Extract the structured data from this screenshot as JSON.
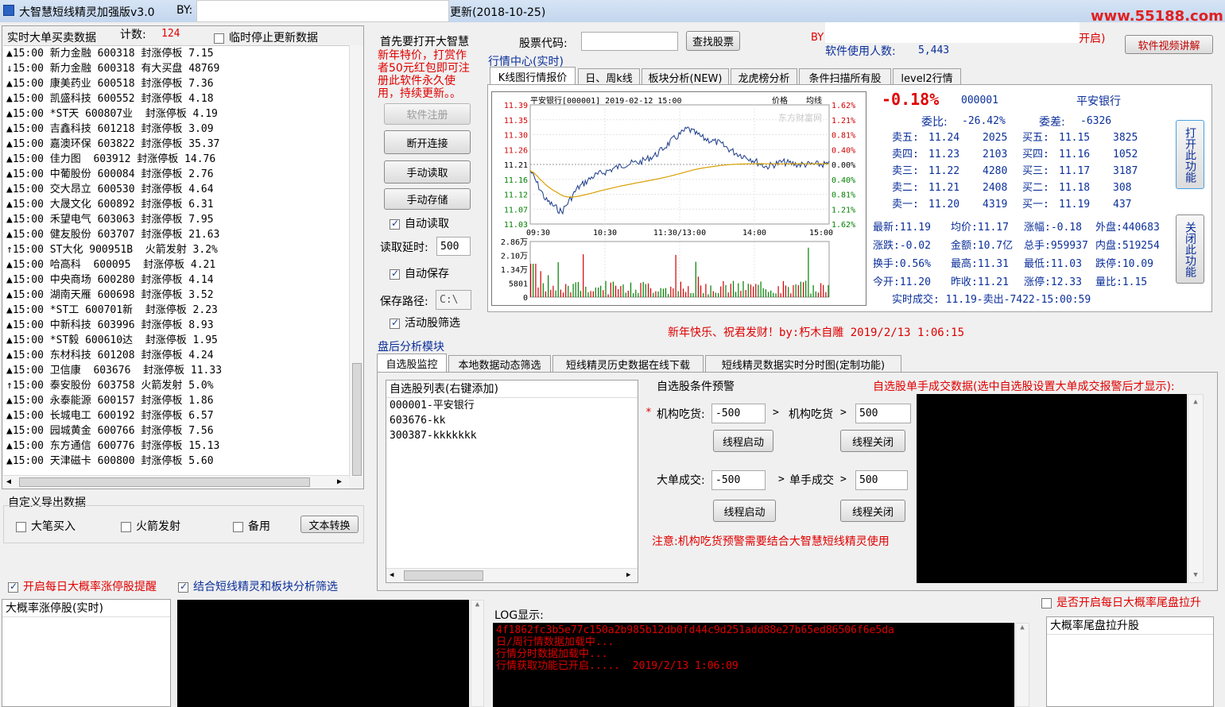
{
  "window": {
    "title": "大智慧短线精灵加强版v3.0",
    "by_label": "BY:",
    "update_suffix": "更新(2018-10-25)",
    "logo_url": "www.55188.com"
  },
  "left": {
    "header_title": "实时大单买卖数据",
    "count_label": "计数:",
    "count_value": "124",
    "pause_label": "临时停止更新数据",
    "rows": [
      {
        "arrow": "▲",
        "text": "15:00 新力金融 600318 封涨停板 7.15"
      },
      {
        "arrow": "↓",
        "text": "15:00 新力金融 600318 有大买盘 48769"
      },
      {
        "arrow": "▲",
        "text": "15:00 康美药业 600518 封涨停板 7.36"
      },
      {
        "arrow": "▲",
        "text": "15:00 凯盛科技 600552 封涨停板 4.18"
      },
      {
        "arrow": "▲",
        "text": "15:00 *ST天 600807业  封涨停板 4.19"
      },
      {
        "arrow": "▲",
        "text": "15:00 吉鑫科技 601218 封涨停板 3.09"
      },
      {
        "arrow": "▲",
        "text": "15:00 嘉澳环保 603822 封涨停板 35.37"
      },
      {
        "arrow": "▲",
        "text": "15:00 佳力图  603912 封涨停板 14.76"
      },
      {
        "arrow": "▲",
        "text": "15:00 中葡股份 600084 封涨停板 2.76"
      },
      {
        "arrow": "▲",
        "text": "15:00 交大昂立 600530 封涨停板 4.64"
      },
      {
        "arrow": "▲",
        "text": "15:00 大晟文化 600892 封涨停板 6.31"
      },
      {
        "arrow": "▲",
        "text": "15:00 禾望电气 603063 封涨停板 7.95"
      },
      {
        "arrow": "▲",
        "text": "15:00 健友股份 603707 封涨停板 21.63"
      },
      {
        "arrow": "↑",
        "text": "15:00 ST大化 900951B  火箭发射 3.2%"
      },
      {
        "arrow": "▲",
        "text": "15:00 哈高科  600095  封涨停板 4.21"
      },
      {
        "arrow": "▲",
        "text": "15:00 中央商场 600280 封涨停板 4.14"
      },
      {
        "arrow": "▲",
        "text": "15:00 湖南天雁 600698 封涨停板 3.52"
      },
      {
        "arrow": "▲",
        "text": "15:00 *ST工 600701新  封涨停板 2.23"
      },
      {
        "arrow": "▲",
        "text": "15:00 中新科技 603996 封涨停板 8.93"
      },
      {
        "arrow": "▲",
        "text": "15:00 *ST毅 600610达  封涨停板 1.95"
      },
      {
        "arrow": "▲",
        "text": "15:00 东材科技 601208 封涨停板 4.24"
      },
      {
        "arrow": "▲",
        "text": "15:00 卫信康  603676  封涨停板 11.33"
      },
      {
        "arrow": "↑",
        "text": "15:00 泰安股份 603758 火箭发射 5.0%"
      },
      {
        "arrow": "▲",
        "text": "15:00 永泰能源 600157 封涨停板 1.86"
      },
      {
        "arrow": "▲",
        "text": "15:00 长城电工 600192 封涨停板 6.57"
      },
      {
        "arrow": "▲",
        "text": "15:00 园城黄金 600766 封涨停板 7.56"
      },
      {
        "arrow": "▲",
        "text": "15:00 东方通信 600776 封涨停板 15.13"
      },
      {
        "arrow": "▲",
        "text": "15:00 天津磁卡 600800 封涨停板 5.60"
      }
    ],
    "export_title": "自定义导出数据",
    "export_items": [
      "大笔买入",
      "火箭发射",
      "备用"
    ],
    "convert_btn": "文本转换",
    "daily_alert": "开启每日大概率涨停股提醒",
    "combine": "结合短线精灵和板块分析筛选",
    "bottom_list_title": "大概率涨停股(实时)"
  },
  "middle": {
    "first_open": "首先要打开大智慧",
    "promo": "新年特价，打赏作者50元红包即可注册此软件永久使用，持续更新。。",
    "register": "软件注册",
    "disconnect": "断开连接",
    "manual_read": "手动读取",
    "manual_save": "手动存储",
    "auto_read": "自动读取",
    "delay_label": "读取延时:",
    "delay_value": "500",
    "auto_save": "自动保存",
    "path_label": "保存路径:",
    "path_value": "C:\\",
    "active_filter": "活动股筛选"
  },
  "top": {
    "code_label": "股票代码:",
    "find_btn": "查找股票",
    "by2": "BY",
    "open_tail": "开启)",
    "video_btn": "软件视频讲解",
    "users_label": "软件使用人数:",
    "users_value": "5,443",
    "market_center": "行情中心(实时)",
    "tabs": [
      "K线图行情报价",
      "日、周k线",
      "板块分析(NEW)",
      "龙虎榜分析",
      "条件扫描所有股",
      "level2行情"
    ]
  },
  "quote": {
    "chart_header": "平安银行[000001] 2019-02-12 15:00",
    "price_legend": "价格",
    "avg_legend": "均线",
    "watermark": "东方财富网",
    "left_ticks": [
      "11.39",
      "11.35",
      "11.30",
      "11.26",
      "11.21",
      "11.16",
      "11.12",
      "11.07",
      "11.03"
    ],
    "right_ticks": [
      "1.62%",
      "1.21%",
      "0.81%",
      "0.40%",
      "0.00%",
      "0.40%",
      "0.81%",
      "1.21%",
      "1.62%"
    ],
    "time_ticks": [
      "09:30",
      "10:30",
      "11:30/13:00",
      "14:00",
      "15:00"
    ],
    "vol_ticks": [
      "2.86万",
      "2.10万",
      "1.34万",
      "5801",
      "0"
    ],
    "change": "-0.18%",
    "code": "000001",
    "name": "平安银行",
    "wb_label": "委比:",
    "wb_value": "-26.42%",
    "wc_label": "委差:",
    "wc_value": "-6326",
    "sells": [
      {
        "l": "卖五:",
        "p": "11.24",
        "v": "2025"
      },
      {
        "l": "卖四:",
        "p": "11.23",
        "v": "2103"
      },
      {
        "l": "卖三:",
        "p": "11.22",
        "v": "4280"
      },
      {
        "l": "卖二:",
        "p": "11.21",
        "v": "2408"
      },
      {
        "l": "卖一:",
        "p": "11.20",
        "v": "4319"
      }
    ],
    "buys": [
      {
        "l": "买五:",
        "p": "11.15",
        "v": "3825"
      },
      {
        "l": "买四:",
        "p": "11.16",
        "v": "1052"
      },
      {
        "l": "买三:",
        "p": "11.17",
        "v": "3187"
      },
      {
        "l": "买二:",
        "p": "11.18",
        "v": "308"
      },
      {
        "l": "买一:",
        "p": "11.19",
        "v": "437"
      }
    ],
    "stats": [
      [
        "最新:11.19",
        "均价:11.17",
        "涨幅:-0.18",
        "外盘:440683"
      ],
      [
        "涨跌:-0.02",
        "金额:10.7亿",
        "总手:959937",
        "内盘:519254"
      ],
      [
        "换手:0.56%",
        "最高:11.31",
        "最低:11.03",
        "跌停:10.09"
      ],
      [
        "今开:11.20",
        "昨收:11.21",
        "涨停:12.33",
        "量比:1.15"
      ]
    ],
    "realtime": "实时成交:  11.19-卖出-7422-15:00:59",
    "open_func": "打开此功能",
    "close_func": "关闭此功能"
  },
  "greeting": "新年快乐、祝君发财！by:朽木自雕 2019/2/13 1:06:15",
  "after": {
    "title": "盘后分析模块",
    "tabs": [
      "自选股监控",
      "本地数据动态筛选",
      "短线精灵历史数据在线下载",
      "短线精灵数据实时分时图(定制功能)"
    ],
    "list_title": "自选股列表(右键添加)",
    "list_items": [
      "000001-平安银行",
      "603676-kk",
      "300387-kkkkkkk"
    ],
    "warn_title": "自选股条件预警",
    "inst_label1": "机构吃货:",
    "inst_value1": "-500",
    "inst_label2": "机构吃货",
    "inst_value2": "500",
    "start": "线程启动",
    "stop": "线程关闭",
    "big_label": "大单成交:",
    "big_value": "-500",
    "single_label": "单手成交",
    "single_value": "500",
    "note": "注意:机构吃货预警需要结合大智慧短线精灵使用",
    "single_trade_title": "自选股单手成交数据(选中自选股设置大单成交报警后才显示):"
  },
  "log": {
    "title": "LOG显示:",
    "lines": [
      "4f1862fc3b5e77c150a2b985b12db0fd44c9d251add88e27b65ed86506f6e5da",
      "日/周行情数据加载中...",
      "行情分时数据加载中...",
      "行情获取功能已开启.....  2019/2/13 1:06:09"
    ]
  },
  "tail": {
    "check": "是否开启每日大概率尾盘拉升",
    "list_title": "大概率尾盘拉升股"
  }
}
